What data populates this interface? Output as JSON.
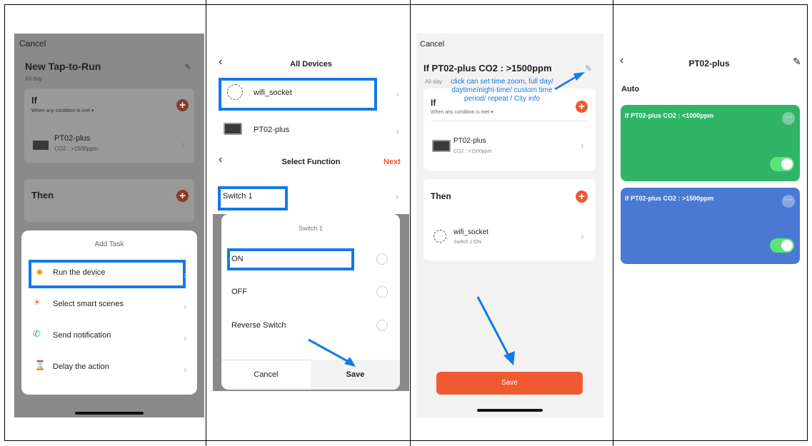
{
  "panel1": {
    "cancel": "Cancel",
    "title": "New Tap-to-Run",
    "subtitle": "All day",
    "if_label": "If",
    "if_sub": "When any condition is met ▾",
    "device_name": "PT02-plus",
    "device_cond": "CO2 : >1500ppm",
    "then_label": "Then",
    "sheet_title": "Add Task",
    "tasks": [
      "Run the device",
      "Select smart scenes",
      "Send notification",
      "Delay the action"
    ]
  },
  "panel2": {
    "header_title": "All Devices",
    "devices": [
      "wifi_socket",
      "PT02-plus"
    ],
    "func_title": "Select Function",
    "next": "Next",
    "switch_label": "Switch 1",
    "dialog_title": "Switch 1",
    "options": [
      "ON",
      "OFF",
      "Reverse Switch"
    ],
    "cancel": "Cancel",
    "save": "Save"
  },
  "panel3": {
    "cancel": "Cancel",
    "title": "If PT02-plus CO2 : >1500ppm",
    "allday": "All day",
    "annotation": "click can set time zoom, full day/ daytime/night-time/ custom time period/ repeat / City info",
    "if_label": "If",
    "if_sub": "When any condition is met ▾",
    "device_name": "PT02-plus",
    "device_cond": "CO2 : >1500ppm",
    "then_label": "Then",
    "action_name": "wifi_socket",
    "action_sub": "Switch 1:ON",
    "save": "Save"
  },
  "panel4": {
    "title": "PT02-plus",
    "section": "Auto",
    "cards": [
      {
        "label": "If PT02-plus CO2 : <1000ppm",
        "color": "#2fb468"
      },
      {
        "label": "If PT02-plus CO2 : >1500ppm",
        "color": "#4a79d4"
      }
    ]
  },
  "colors": {
    "accent": "#f05a33",
    "highlight": "#1479e6"
  }
}
